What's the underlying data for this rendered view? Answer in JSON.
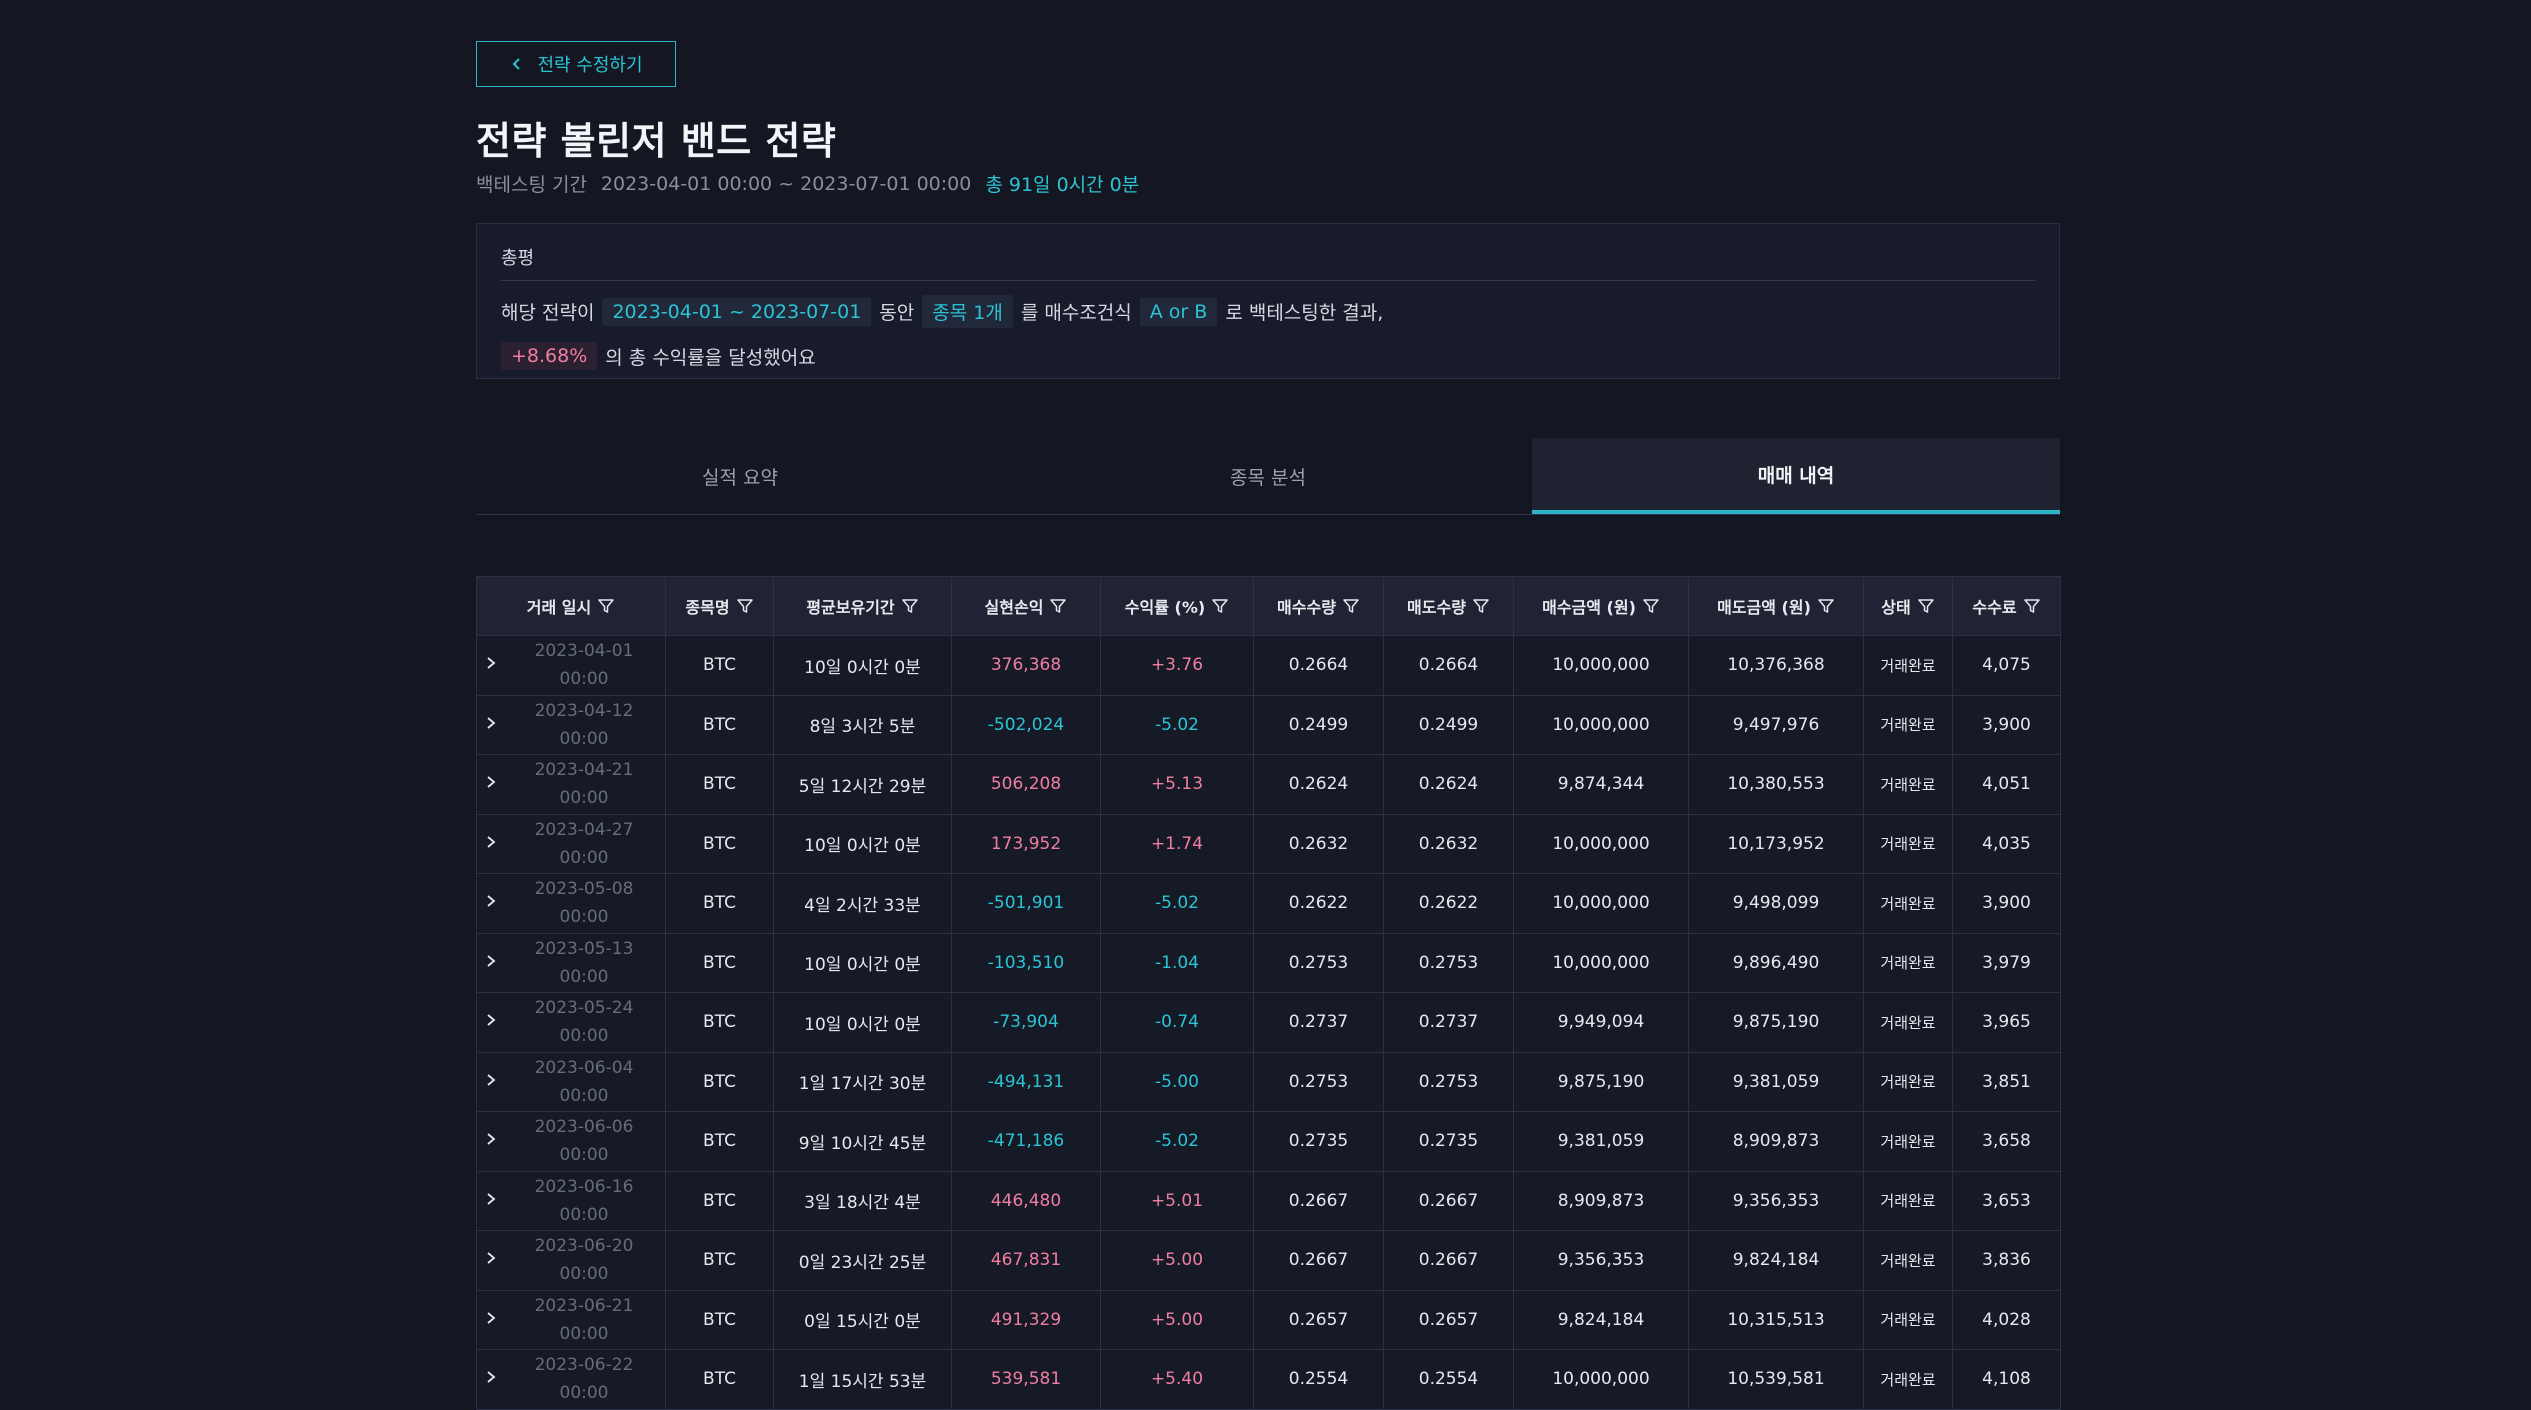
{
  "back_button": {
    "label": "전략 수정하기"
  },
  "title": "전략 볼린저 밴드 전략",
  "period": {
    "label": "백테스팅 기간",
    "range": "2023-04-01 00:00 ~ 2023-07-01 00:00",
    "total": "총 91일 0시간 0분"
  },
  "summary": {
    "title": "총평",
    "t1": "해당 전략이",
    "date_range": "2023-04-01 ~ 2023-07-01",
    "t2": "동안",
    "stock_count": "종목 1개",
    "t3": "를 매수조건식",
    "condition": "A or B",
    "t4": "로 백테스팅한 결과,",
    "return": "+8.68%",
    "t5": "의 총 수익률을 달성했어요"
  },
  "tabs": [
    "실적 요약",
    "종목 분석",
    "매매 내역"
  ],
  "table": {
    "headers": [
      "거래 일시",
      "종목명",
      "평균보유기간",
      "실현손익",
      "수익률 (%)",
      "매수수량",
      "매도수량",
      "매수금액 (원)",
      "매도금액 (원)",
      "상태",
      "수수료"
    ],
    "rows": [
      {
        "date": "2023-04-01",
        "time": "00:00",
        "name": "BTC",
        "hold": "10일 0시간 0분",
        "pnl": "376,368",
        "rate": "+3.76",
        "buy_qty": "0.2664",
        "sell_qty": "0.2664",
        "buy_amt": "10,000,000",
        "sell_amt": "10,376,368",
        "status": "거래완료",
        "fee": "4,075",
        "sign": "pos"
      },
      {
        "date": "2023-04-12",
        "time": "00:00",
        "name": "BTC",
        "hold": "8일 3시간 5분",
        "pnl": "-502,024",
        "rate": "-5.02",
        "buy_qty": "0.2499",
        "sell_qty": "0.2499",
        "buy_amt": "10,000,000",
        "sell_amt": "9,497,976",
        "status": "거래완료",
        "fee": "3,900",
        "sign": "neg"
      },
      {
        "date": "2023-04-21",
        "time": "00:00",
        "name": "BTC",
        "hold": "5일 12시간 29분",
        "pnl": "506,208",
        "rate": "+5.13",
        "buy_qty": "0.2624",
        "sell_qty": "0.2624",
        "buy_amt": "9,874,344",
        "sell_amt": "10,380,553",
        "status": "거래완료",
        "fee": "4,051",
        "sign": "pos"
      },
      {
        "date": "2023-04-27",
        "time": "00:00",
        "name": "BTC",
        "hold": "10일 0시간 0분",
        "pnl": "173,952",
        "rate": "+1.74",
        "buy_qty": "0.2632",
        "sell_qty": "0.2632",
        "buy_amt": "10,000,000",
        "sell_amt": "10,173,952",
        "status": "거래완료",
        "fee": "4,035",
        "sign": "pos"
      },
      {
        "date": "2023-05-08",
        "time": "00:00",
        "name": "BTC",
        "hold": "4일 2시간 33분",
        "pnl": "-501,901",
        "rate": "-5.02",
        "buy_qty": "0.2622",
        "sell_qty": "0.2622",
        "buy_amt": "10,000,000",
        "sell_amt": "9,498,099",
        "status": "거래완료",
        "fee": "3,900",
        "sign": "neg"
      },
      {
        "date": "2023-05-13",
        "time": "00:00",
        "name": "BTC",
        "hold": "10일 0시간 0분",
        "pnl": "-103,510",
        "rate": "-1.04",
        "buy_qty": "0.2753",
        "sell_qty": "0.2753",
        "buy_amt": "10,000,000",
        "sell_amt": "9,896,490",
        "status": "거래완료",
        "fee": "3,979",
        "sign": "neg"
      },
      {
        "date": "2023-05-24",
        "time": "00:00",
        "name": "BTC",
        "hold": "10일 0시간 0분",
        "pnl": "-73,904",
        "rate": "-0.74",
        "buy_qty": "0.2737",
        "sell_qty": "0.2737",
        "buy_amt": "9,949,094",
        "sell_amt": "9,875,190",
        "status": "거래완료",
        "fee": "3,965",
        "sign": "neg"
      },
      {
        "date": "2023-06-04",
        "time": "00:00",
        "name": "BTC",
        "hold": "1일 17시간 30분",
        "pnl": "-494,131",
        "rate": "-5.00",
        "buy_qty": "0.2753",
        "sell_qty": "0.2753",
        "buy_amt": "9,875,190",
        "sell_amt": "9,381,059",
        "status": "거래완료",
        "fee": "3,851",
        "sign": "neg"
      },
      {
        "date": "2023-06-06",
        "time": "00:00",
        "name": "BTC",
        "hold": "9일 10시간 45분",
        "pnl": "-471,186",
        "rate": "-5.02",
        "buy_qty": "0.2735",
        "sell_qty": "0.2735",
        "buy_amt": "9,381,059",
        "sell_amt": "8,909,873",
        "status": "거래완료",
        "fee": "3,658",
        "sign": "neg"
      },
      {
        "date": "2023-06-16",
        "time": "00:00",
        "name": "BTC",
        "hold": "3일 18시간 4분",
        "pnl": "446,480",
        "rate": "+5.01",
        "buy_qty": "0.2667",
        "sell_qty": "0.2667",
        "buy_amt": "8,909,873",
        "sell_amt": "9,356,353",
        "status": "거래완료",
        "fee": "3,653",
        "sign": "pos"
      },
      {
        "date": "2023-06-20",
        "time": "00:00",
        "name": "BTC",
        "hold": "0일 23시간 25분",
        "pnl": "467,831",
        "rate": "+5.00",
        "buy_qty": "0.2667",
        "sell_qty": "0.2667",
        "buy_amt": "9,356,353",
        "sell_amt": "9,824,184",
        "status": "거래완료",
        "fee": "3,836",
        "sign": "pos"
      },
      {
        "date": "2023-06-21",
        "time": "00:00",
        "name": "BTC",
        "hold": "0일 15시간 0분",
        "pnl": "491,329",
        "rate": "+5.00",
        "buy_qty": "0.2657",
        "sell_qty": "0.2657",
        "buy_amt": "9,824,184",
        "sell_amt": "10,315,513",
        "status": "거래완료",
        "fee": "4,028",
        "sign": "pos"
      },
      {
        "date": "2023-06-22",
        "time": "00:00",
        "name": "BTC",
        "hold": "1일 15시간 53분",
        "pnl": "539,581",
        "rate": "+5.40",
        "buy_qty": "0.2554",
        "sell_qty": "0.2554",
        "buy_amt": "10,000,000",
        "sell_amt": "10,539,581",
        "status": "거래완료",
        "fee": "4,108",
        "sign": "pos"
      }
    ]
  },
  "colors": {
    "accent": "#2bc4d4",
    "positive": "#f07ea0",
    "negative": "#2bc4d4",
    "background": "#141722"
  }
}
